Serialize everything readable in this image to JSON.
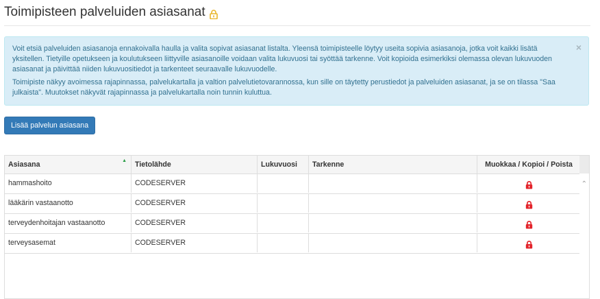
{
  "header": {
    "title": "Toimipisteen palveluiden asiasanat",
    "title_icon": "lock-icon",
    "lock_color": "#e8b52b"
  },
  "alert": {
    "paragraph_1": "Voit etsiä palveluiden asiasanoja ennakoivalla haulla ja valita sopivat asiasanat listalta. Yleensä toimipisteelle löytyy useita sopivia asiasanoja, jotka voit kaikki lisätä yksitellen. Tietyille opetukseen ja koulutukseen liittyville asiasanoille voidaan valita lukuvuosi tai syöttää tarkenne. Voit kopioida esimerkiksi olemassa olevan lukuvuoden asiasanat ja päivittää niiden lukuvuositiedot ja tarkenteet seuraavalle lukuvuodelle.",
    "paragraph_2": "Toimipiste näkyy avoimessa rajapinnassa, palvelukartalla ja valtion palvelutietovarannossa, kun sille on täytetty perustiedot ja palveluiden asiasanat, ja se on tilassa \"Saa julkaista\". Muutokset näkyvät rajapinnassa ja palvelukartalla noin tunnin kuluttua.",
    "close_label": "×",
    "background": "#d9edf7",
    "text_color": "#31708f"
  },
  "toolbar": {
    "add_label": "Lisää palvelun asiasana",
    "accent": "#337ab7"
  },
  "table": {
    "columns": [
      "Asiasana",
      "Tietolähde",
      "Lukuvuosi",
      "Tarkenne",
      "Muokkaa / Kopioi / Poista"
    ],
    "sort_icon": "sort-asc-icon",
    "rows": [
      {
        "asiasana": "hammashoito",
        "tietolahde": "CODESERVER",
        "lukuvuosi": "",
        "tarkenne": ""
      },
      {
        "asiasana": "lääkärin vastaanotto",
        "tietolahde": "CODESERVER",
        "lukuvuosi": "",
        "tarkenne": ""
      },
      {
        "asiasana": "terveydenhoitajan vastaanotto",
        "tietolahde": "CODESERVER",
        "lukuvuosi": "",
        "tarkenne": ""
      },
      {
        "asiasana": "terveysasemat",
        "tietolahde": "CODESERVER",
        "lukuvuosi": "",
        "tarkenne": ""
      }
    ],
    "row_action_icon": "red-lock-icon",
    "row_lock_color": "#e3242b"
  }
}
